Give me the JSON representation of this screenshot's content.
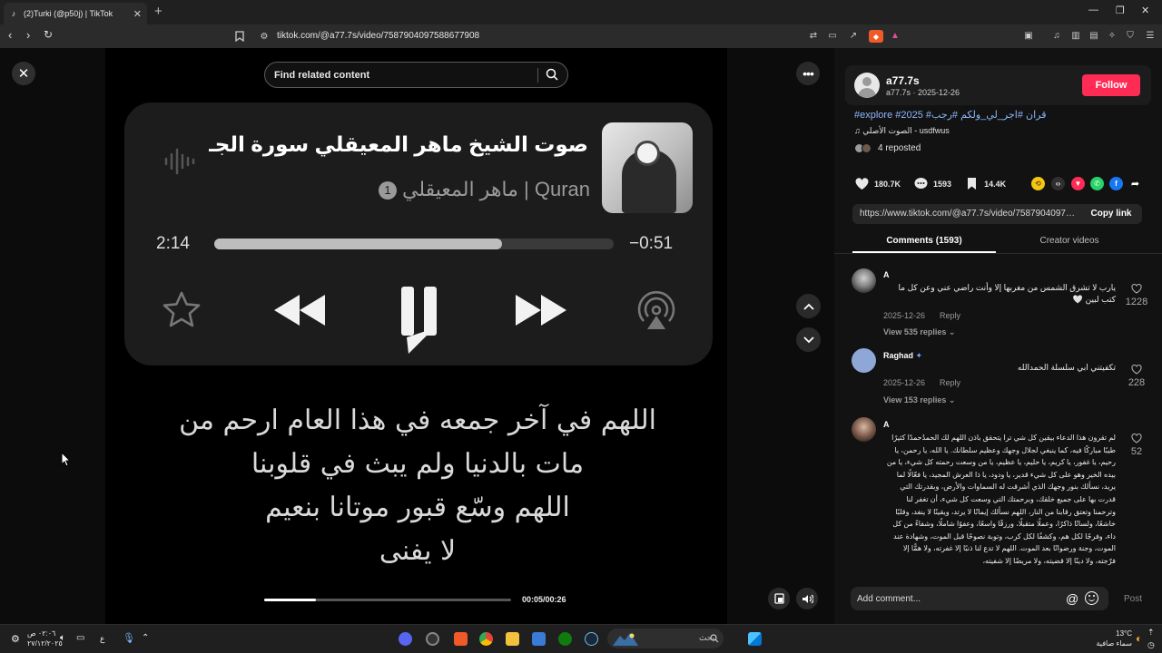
{
  "browser": {
    "tab_title": "(2)Turki (@p50j) | TikTok",
    "url": "tiktok.com/@a77.7s/video/7587904097588677908"
  },
  "search": {
    "placeholder": "Find related content"
  },
  "player_card": {
    "song_title": "صوت الشيخ ماهر المعيقلي سورة الجـ",
    "badge": "1",
    "subtitle": "ماهر المعيقلي | Quran",
    "elapsed": "2:14",
    "remaining": "−0:51",
    "progress": 0.72
  },
  "lyrics": {
    "line1": "اللهم في آخر جمعه في هذا العام ارحم من",
    "line2": "مات بالدنيا ولم يبث في قلوبنا",
    "line3": "اللهم وسّع قبور موتانا بنعيم",
    "line4": "لا يفنى"
  },
  "video": {
    "time": "00:05/00:26",
    "progress": 0.21
  },
  "author": {
    "name": "a77.7s",
    "handle_date": "a77.7s · 2025-12-26",
    "follow_label": "Follow",
    "hashtags": "#explore #2025 #قران #اجر_لي_ولكم #رجب",
    "music": "الصوت الأصلي - usdfwus",
    "reposted": "4 reposted"
  },
  "stats": {
    "likes": "180.7K",
    "comments": "1593",
    "saves": "14.4K"
  },
  "link": {
    "url": "https://www.tiktok.com/@a77.7s/video/758790409758...",
    "copy_label": "Copy link"
  },
  "tabs": {
    "comments": "Comments (1593)",
    "creator_videos": "Creator videos"
  },
  "comments": [
    {
      "name": "A",
      "text": "يارب لا تشرق الشمس من مغربها إلا وأنت راضي عني وعن كل ما كتب لبين 🤍",
      "date": "2025-12-26",
      "reply": "Reply",
      "replies": "View 535 replies",
      "likes": "1228"
    },
    {
      "name": "Raghad",
      "text": "تكفيتني ابي سلسلة الحمدالله",
      "date": "2025-12-26",
      "reply": "Reply",
      "replies": "View 153 replies",
      "likes": "228"
    },
    {
      "name": "A",
      "text": "لم تقرون هذا الدعاء بيقين كل شي ترا يتحقق باذن اللهم لك الحمدُحمدًا كثيرًا طيبًا مباركًا فيه، كما ينبغي لجلال وجهك وعظيم سلطانك. يا الله، يا رحمن، يا رحيم، يا غفور، يا كريم، يا حليم، يا عظيم، يا من وسعت رحمته كل شيء، يا من بيده الخير وهو على كل شيء قدير، يا ودود، يا ذا العرش المجيد، يا فعّالًا لما يريد، نسألك بنور وجهك الذي أشرقت له السماوات والأرض، وبقدرتك التي قدرت بها على جميع خلقك، وبرحمتك التي وسعت كل شيء، أن تغفر لنا وترحمنا وتعتق رقابنا من النار، اللهم نسألك إيمانًا لا يرتد، ويقينًا لا ينفد، وقلبًا خاشعًا، ولسانًا ذاكرًا، وعملًا متقبلًا، ورزقًا واسعًا، وعفوًا شاملًا، وشفاءً من كل داء، وفرجًا لكل هم، وكشفًا لكل كرب، وتوبة نصوحًا قبل الموت، وشهادة عند الموت، وجنة ورضوانًا بعد الموت. اللهم لا تدع لنا ذنبًا إلا غفرته، ولا همًّا إلا فرّجته، ولا دينًا إلا قضيته، ولا مريضًا إلا شفيته،",
      "likes": "52"
    }
  ],
  "comment_input": {
    "placeholder": "Add comment...",
    "at": "@",
    "post_label": "Post"
  },
  "taskbar": {
    "search_label": "بحث",
    "weather_temp": "13°C",
    "weather_desc": "سماء صافية",
    "clock_time": "٠٢:٠٦ ص",
    "clock_date": "٢٧/١٢/٢٠٢٥",
    "lang": "ع"
  },
  "colors": {
    "accent": "#fe2c55",
    "hashtag": "#8eb6ff",
    "panel_bg": "#121212"
  }
}
